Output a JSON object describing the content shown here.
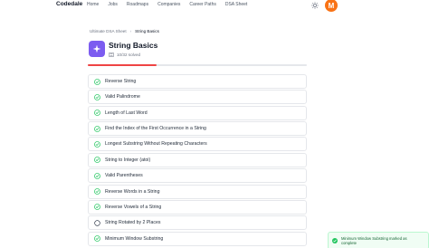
{
  "nav": {
    "brand": "Codedale",
    "links": [
      "Home",
      "Jobs",
      "Roadmaps",
      "Companies",
      "Career Paths",
      "DSA Sheet"
    ],
    "avatar_initial": "M"
  },
  "breadcrumb": {
    "parent": "Ultimate DSA Sheet",
    "separator": "›",
    "current": "String Basics"
  },
  "header": {
    "title": "String Basics",
    "solved_text": "10/32 solved"
  },
  "progress": {
    "solved": 10,
    "total": 32
  },
  "problems": [
    {
      "title": "Reverse String",
      "solved": true
    },
    {
      "title": "Valid Palindrome",
      "solved": true
    },
    {
      "title": "Length of Last Word",
      "solved": true
    },
    {
      "title": "Find the Index of the First Occurrence in a String",
      "solved": true
    },
    {
      "title": "Longest Substring Without Repeating Characters",
      "solved": true
    },
    {
      "title": "String to Integer (atoi)",
      "solved": true
    },
    {
      "title": "Valid Parentheses",
      "solved": true
    },
    {
      "title": "Reverse Words in a String",
      "solved": true
    },
    {
      "title": "Reverse Vowels of a String",
      "solved": true
    },
    {
      "title": "String Rotated by 2 Places",
      "solved": false
    },
    {
      "title": "Minimum Window Substring",
      "solved": true
    }
  ],
  "toast": {
    "message": "Minimum Window Substring marked as complete"
  },
  "colors": {
    "accent": "#7c5cf0",
    "success": "#22c55e",
    "progress": "#ef4444",
    "avatar": "#f97316"
  },
  "icons": {
    "header": "sparkle-icon",
    "solved_row": "list-icon",
    "theme": "sun-icon",
    "solved": "check-circle-icon",
    "unsolved": "empty-circle-icon",
    "toast": "check-circle-icon"
  }
}
